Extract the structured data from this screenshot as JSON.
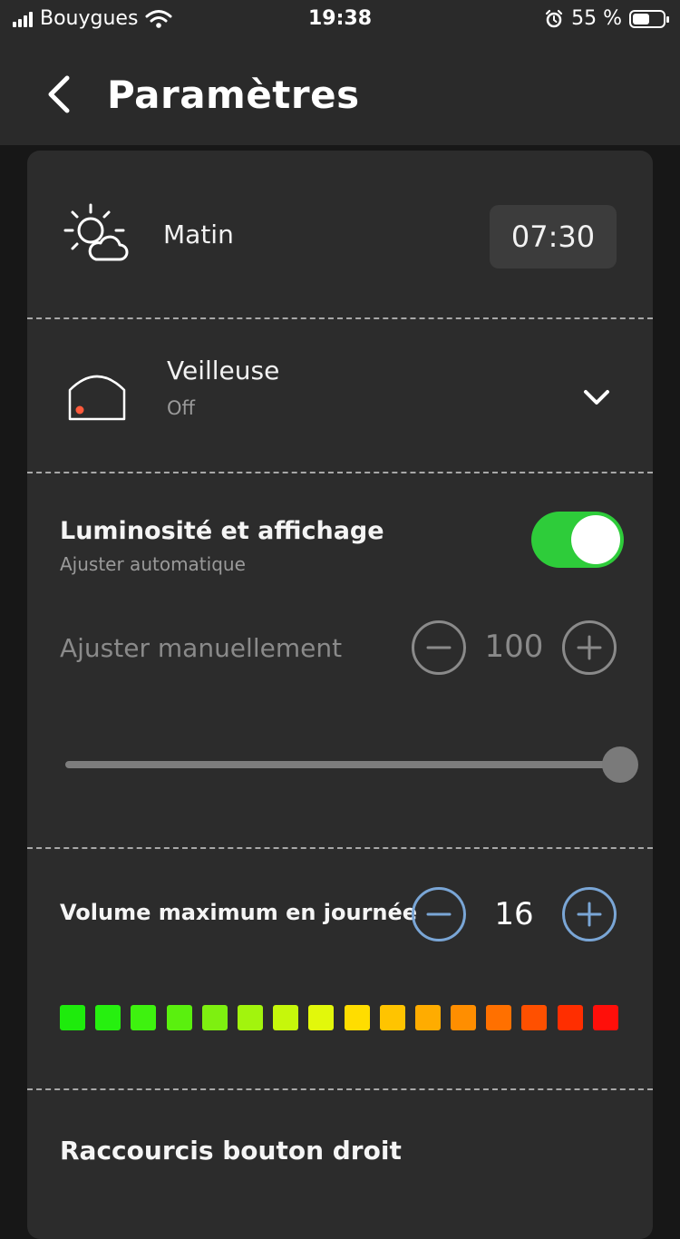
{
  "status": {
    "carrier": "Bouygues",
    "time": "19:38",
    "battery": "55 %",
    "battery_level": 0.55
  },
  "nav": {
    "title": "Paramètres"
  },
  "alarm": {
    "label": "Matin",
    "time": "07:30"
  },
  "nightlight": {
    "title": "Veilleuse",
    "status": "Off"
  },
  "brightness": {
    "title": "Luminosité et affichage",
    "subtitle": "Ajuster automatique",
    "auto_enabled": true,
    "manual_label": "Ajuster manuellement",
    "value": "100",
    "slider_level": 1.0
  },
  "volume": {
    "title": "Volume maximum en journée",
    "value": "16",
    "level_colors": [
      "#1eeb0c",
      "#26f00f",
      "#3ef20f",
      "#5af00e",
      "#7ef010",
      "#a2f40d",
      "#c6f70b",
      "#e2f80b",
      "#ffdd00",
      "#ffc400",
      "#ffac00",
      "#ff8e00",
      "#ff7000",
      "#ff5000",
      "#ff2e00",
      "#ff0f0a"
    ]
  },
  "shortcuts": {
    "title": "Raccourcis bouton droit"
  },
  "colors": {
    "accent_toggle": "#2ecc3a",
    "accent_blue": "#7aa6d6",
    "card_bg": "#2c2c2c",
    "nav_bg": "#2a2a2a"
  }
}
